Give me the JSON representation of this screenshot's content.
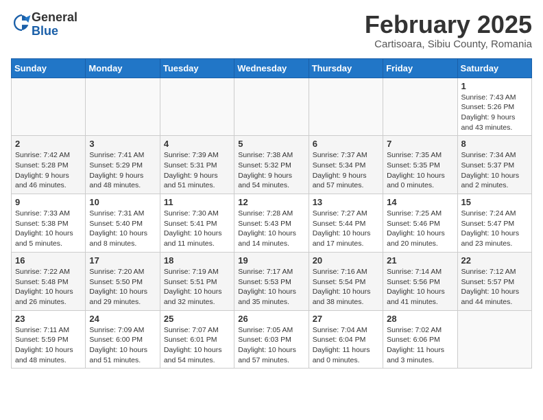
{
  "header": {
    "logo_general": "General",
    "logo_blue": "Blue",
    "month_year": "February 2025",
    "location": "Cartisoara, Sibiu County, Romania"
  },
  "weekdays": [
    "Sunday",
    "Monday",
    "Tuesday",
    "Wednesday",
    "Thursday",
    "Friday",
    "Saturday"
  ],
  "weeks": [
    [
      {
        "day": "",
        "info": ""
      },
      {
        "day": "",
        "info": ""
      },
      {
        "day": "",
        "info": ""
      },
      {
        "day": "",
        "info": ""
      },
      {
        "day": "",
        "info": ""
      },
      {
        "day": "",
        "info": ""
      },
      {
        "day": "1",
        "info": "Sunrise: 7:43 AM\nSunset: 5:26 PM\nDaylight: 9 hours and 43 minutes."
      }
    ],
    [
      {
        "day": "2",
        "info": "Sunrise: 7:42 AM\nSunset: 5:28 PM\nDaylight: 9 hours and 46 minutes."
      },
      {
        "day": "3",
        "info": "Sunrise: 7:41 AM\nSunset: 5:29 PM\nDaylight: 9 hours and 48 minutes."
      },
      {
        "day": "4",
        "info": "Sunrise: 7:39 AM\nSunset: 5:31 PM\nDaylight: 9 hours and 51 minutes."
      },
      {
        "day": "5",
        "info": "Sunrise: 7:38 AM\nSunset: 5:32 PM\nDaylight: 9 hours and 54 minutes."
      },
      {
        "day": "6",
        "info": "Sunrise: 7:37 AM\nSunset: 5:34 PM\nDaylight: 9 hours and 57 minutes."
      },
      {
        "day": "7",
        "info": "Sunrise: 7:35 AM\nSunset: 5:35 PM\nDaylight: 10 hours and 0 minutes."
      },
      {
        "day": "8",
        "info": "Sunrise: 7:34 AM\nSunset: 5:37 PM\nDaylight: 10 hours and 2 minutes."
      }
    ],
    [
      {
        "day": "9",
        "info": "Sunrise: 7:33 AM\nSunset: 5:38 PM\nDaylight: 10 hours and 5 minutes."
      },
      {
        "day": "10",
        "info": "Sunrise: 7:31 AM\nSunset: 5:40 PM\nDaylight: 10 hours and 8 minutes."
      },
      {
        "day": "11",
        "info": "Sunrise: 7:30 AM\nSunset: 5:41 PM\nDaylight: 10 hours and 11 minutes."
      },
      {
        "day": "12",
        "info": "Sunrise: 7:28 AM\nSunset: 5:43 PM\nDaylight: 10 hours and 14 minutes."
      },
      {
        "day": "13",
        "info": "Sunrise: 7:27 AM\nSunset: 5:44 PM\nDaylight: 10 hours and 17 minutes."
      },
      {
        "day": "14",
        "info": "Sunrise: 7:25 AM\nSunset: 5:46 PM\nDaylight: 10 hours and 20 minutes."
      },
      {
        "day": "15",
        "info": "Sunrise: 7:24 AM\nSunset: 5:47 PM\nDaylight: 10 hours and 23 minutes."
      }
    ],
    [
      {
        "day": "16",
        "info": "Sunrise: 7:22 AM\nSunset: 5:48 PM\nDaylight: 10 hours and 26 minutes."
      },
      {
        "day": "17",
        "info": "Sunrise: 7:20 AM\nSunset: 5:50 PM\nDaylight: 10 hours and 29 minutes."
      },
      {
        "day": "18",
        "info": "Sunrise: 7:19 AM\nSunset: 5:51 PM\nDaylight: 10 hours and 32 minutes."
      },
      {
        "day": "19",
        "info": "Sunrise: 7:17 AM\nSunset: 5:53 PM\nDaylight: 10 hours and 35 minutes."
      },
      {
        "day": "20",
        "info": "Sunrise: 7:16 AM\nSunset: 5:54 PM\nDaylight: 10 hours and 38 minutes."
      },
      {
        "day": "21",
        "info": "Sunrise: 7:14 AM\nSunset: 5:56 PM\nDaylight: 10 hours and 41 minutes."
      },
      {
        "day": "22",
        "info": "Sunrise: 7:12 AM\nSunset: 5:57 PM\nDaylight: 10 hours and 44 minutes."
      }
    ],
    [
      {
        "day": "23",
        "info": "Sunrise: 7:11 AM\nSunset: 5:59 PM\nDaylight: 10 hours and 48 minutes."
      },
      {
        "day": "24",
        "info": "Sunrise: 7:09 AM\nSunset: 6:00 PM\nDaylight: 10 hours and 51 minutes."
      },
      {
        "day": "25",
        "info": "Sunrise: 7:07 AM\nSunset: 6:01 PM\nDaylight: 10 hours and 54 minutes."
      },
      {
        "day": "26",
        "info": "Sunrise: 7:05 AM\nSunset: 6:03 PM\nDaylight: 10 hours and 57 minutes."
      },
      {
        "day": "27",
        "info": "Sunrise: 7:04 AM\nSunset: 6:04 PM\nDaylight: 11 hours and 0 minutes."
      },
      {
        "day": "28",
        "info": "Sunrise: 7:02 AM\nSunset: 6:06 PM\nDaylight: 11 hours and 3 minutes."
      },
      {
        "day": "",
        "info": ""
      }
    ]
  ]
}
